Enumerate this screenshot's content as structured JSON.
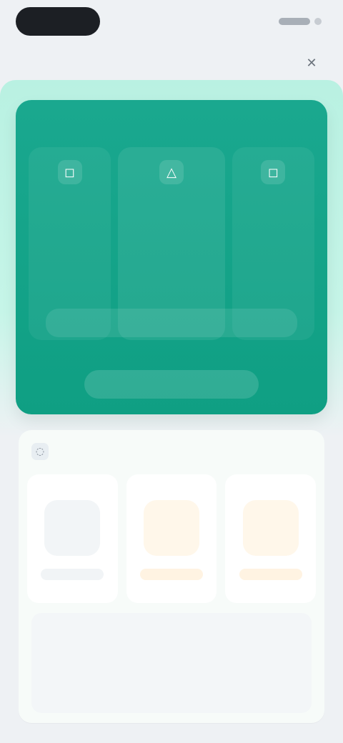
{
  "status_bar": {
    "pill_text": ""
  },
  "header": {
    "title": "",
    "action_icon": "close-icon"
  },
  "hero": {
    "topline": "",
    "col_left_small": "",
    "col_left_metric": "",
    "col_left_sub": "",
    "col_center_small": "",
    "col_center_metric": "",
    "col_center_sub": "",
    "col_right_small": "",
    "col_right_metric": "",
    "col_right_sub": "",
    "row_pill": "",
    "button": ""
  },
  "lower": {
    "section_title": "",
    "cards": [
      {
        "label": "",
        "icon": "",
        "foot": ""
      },
      {
        "label": "",
        "icon": "",
        "foot": ""
      },
      {
        "label": "",
        "icon": "",
        "foot": ""
      }
    ],
    "paragraph": ""
  },
  "colors": {
    "mint": "#c6f5e8",
    "teal": "#12a186",
    "warm": "#d8a14a"
  }
}
